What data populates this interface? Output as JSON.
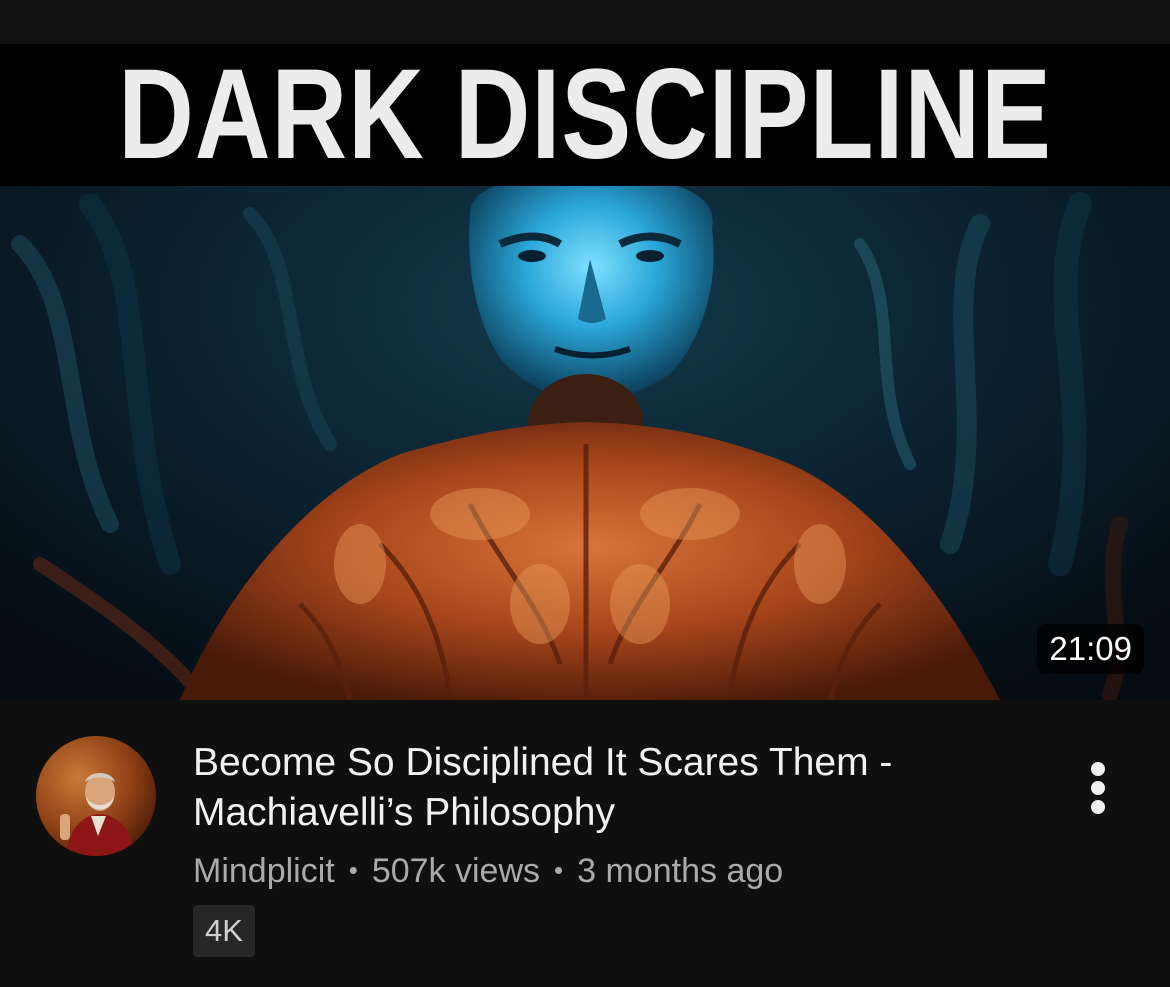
{
  "video": {
    "thumbnail_title": "DARK DISCIPLINE",
    "duration": "21:09",
    "title": "Become So Disciplined It Scares Them - Machiavelli’s Philosophy",
    "channel": "Mindplicit",
    "views": "507k views",
    "age": "3 months ago",
    "separator": "•",
    "badge": "4K"
  },
  "icons": {
    "more": "more-vert-icon"
  },
  "colors": {
    "background": "#0f0f0f",
    "title_text": "#f1f1f1",
    "meta_text": "#aaaaaa",
    "badge_bg": "#272727",
    "thumb_blue": "#2aa7d9",
    "thumb_skin": "#a8461c"
  }
}
